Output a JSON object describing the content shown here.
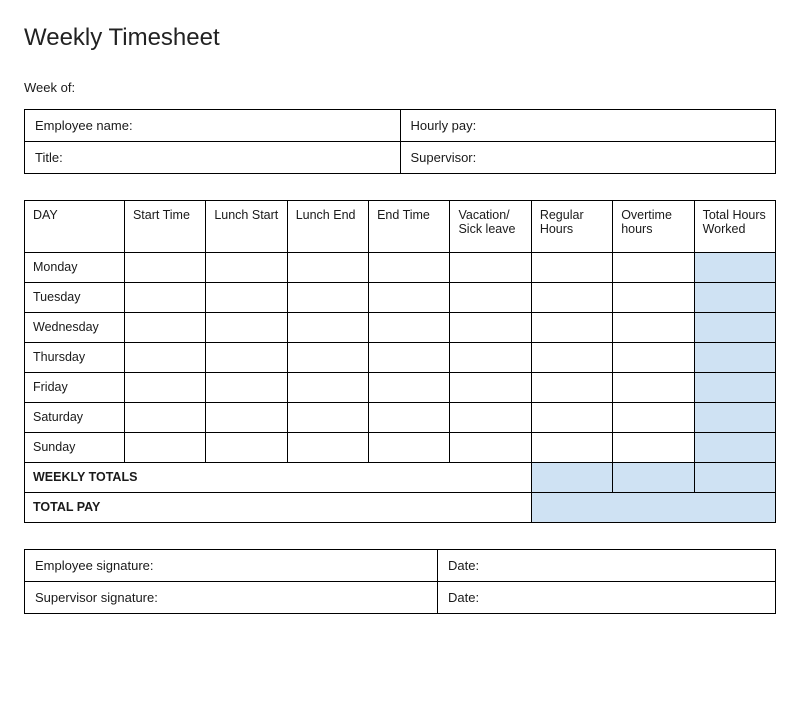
{
  "title": "Weekly Timesheet",
  "week_of_label": "Week of:",
  "info": {
    "employee_name_label": "Employee name:",
    "hourly_pay_label": "Hourly pay:",
    "title_label": "Title:",
    "supervisor_label": "Supervisor:"
  },
  "main": {
    "headers": [
      "DAY",
      "Start Time",
      "Lunch Start",
      "Lunch End",
      "End Time",
      "Vacation/ Sick leave",
      "Regular Hours",
      "Overtime hours",
      "Total Hours Worked"
    ],
    "days": [
      "Monday",
      "Tuesday",
      "Wednesday",
      "Thursday",
      "Friday",
      "Saturday",
      "Sunday"
    ],
    "weekly_totals_label": "WEEKLY TOTALS",
    "total_pay_label": "TOTAL PAY"
  },
  "signatures": {
    "employee_sig_label": "Employee signature:",
    "supervisor_sig_label": "Supervisor signature:",
    "date_label": "Date:"
  }
}
